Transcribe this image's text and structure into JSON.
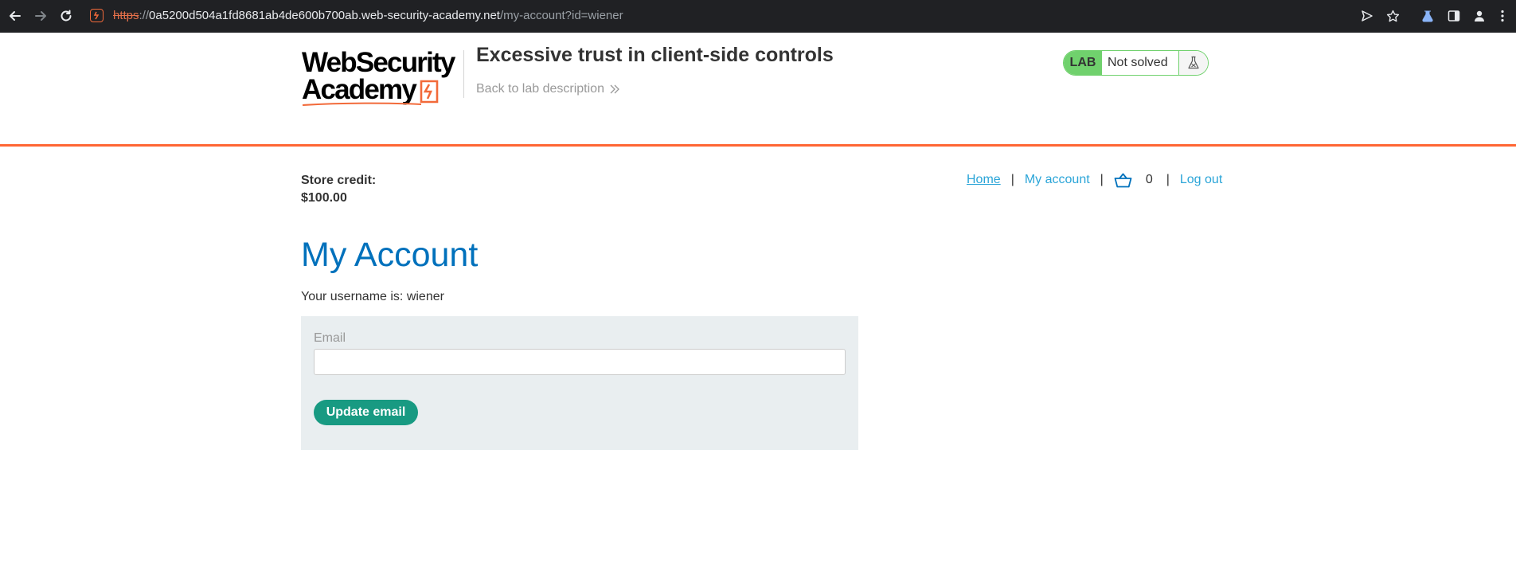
{
  "browser": {
    "url_scheme": "https",
    "url_separator": "://",
    "url_host": "0a5200d504a1fd8681ab4de600b700ab.web-security-academy.net",
    "url_path": "/my-account?id=wiener"
  },
  "header": {
    "logo_line1": "WebSecurity",
    "logo_line2": "Academy",
    "lab_title": "Excessive trust in client-side controls",
    "back_link": "Back to lab description",
    "lab_badge": "LAB",
    "lab_status": "Not solved"
  },
  "store": {
    "credit_label": "Store credit:",
    "credit_value": "$100.00"
  },
  "nav": {
    "home": "Home",
    "my_account": "My account",
    "cart_count": "0",
    "logout": "Log out",
    "separator": "|"
  },
  "main": {
    "title": "My Account",
    "username_text": "Your username is: wiener",
    "email_label": "Email",
    "email_value": "",
    "update_button": "Update email"
  },
  "colors": {
    "accent_orange": "#ff6633",
    "link_blue": "#2ba5d8",
    "title_blue": "#0071bc",
    "button_green": "#189a82",
    "lab_green": "#70d16d"
  }
}
